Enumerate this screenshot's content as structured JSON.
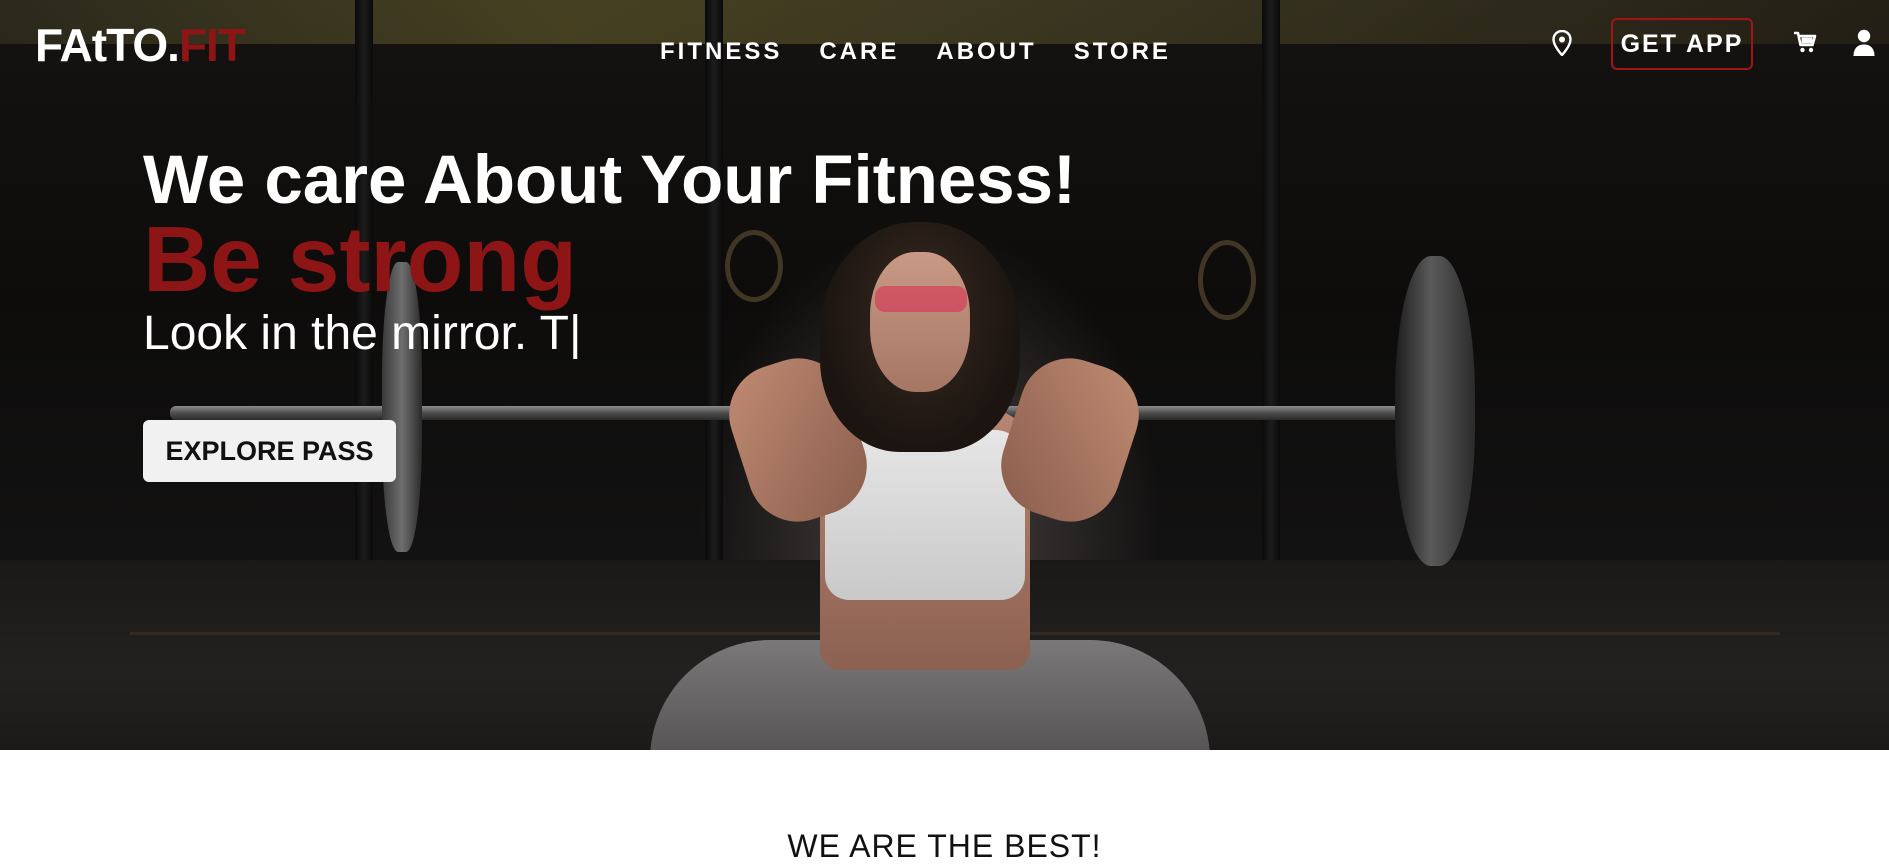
{
  "brand": {
    "name_main": "FAtTO.",
    "name_accent": "FIT",
    "accent_color": "#8e1515"
  },
  "nav": {
    "items": [
      {
        "label": "FITNESS"
      },
      {
        "label": "CARE"
      },
      {
        "label": "ABOUT"
      },
      {
        "label": "STORE"
      }
    ]
  },
  "header_actions": {
    "location_icon": "map-pin-icon",
    "get_app_label": "GET APP",
    "get_app_border_color": "#a31515",
    "cart_icon": "cart-icon",
    "user_icon": "user-icon"
  },
  "hero": {
    "headline": "We care About Your Fitness!",
    "tagline": "Be strong",
    "typed_text": "Look in the mirror. T|",
    "cta_label": "EXPLORE PASS"
  },
  "section": {
    "title": "WE ARE THE BEST!"
  }
}
